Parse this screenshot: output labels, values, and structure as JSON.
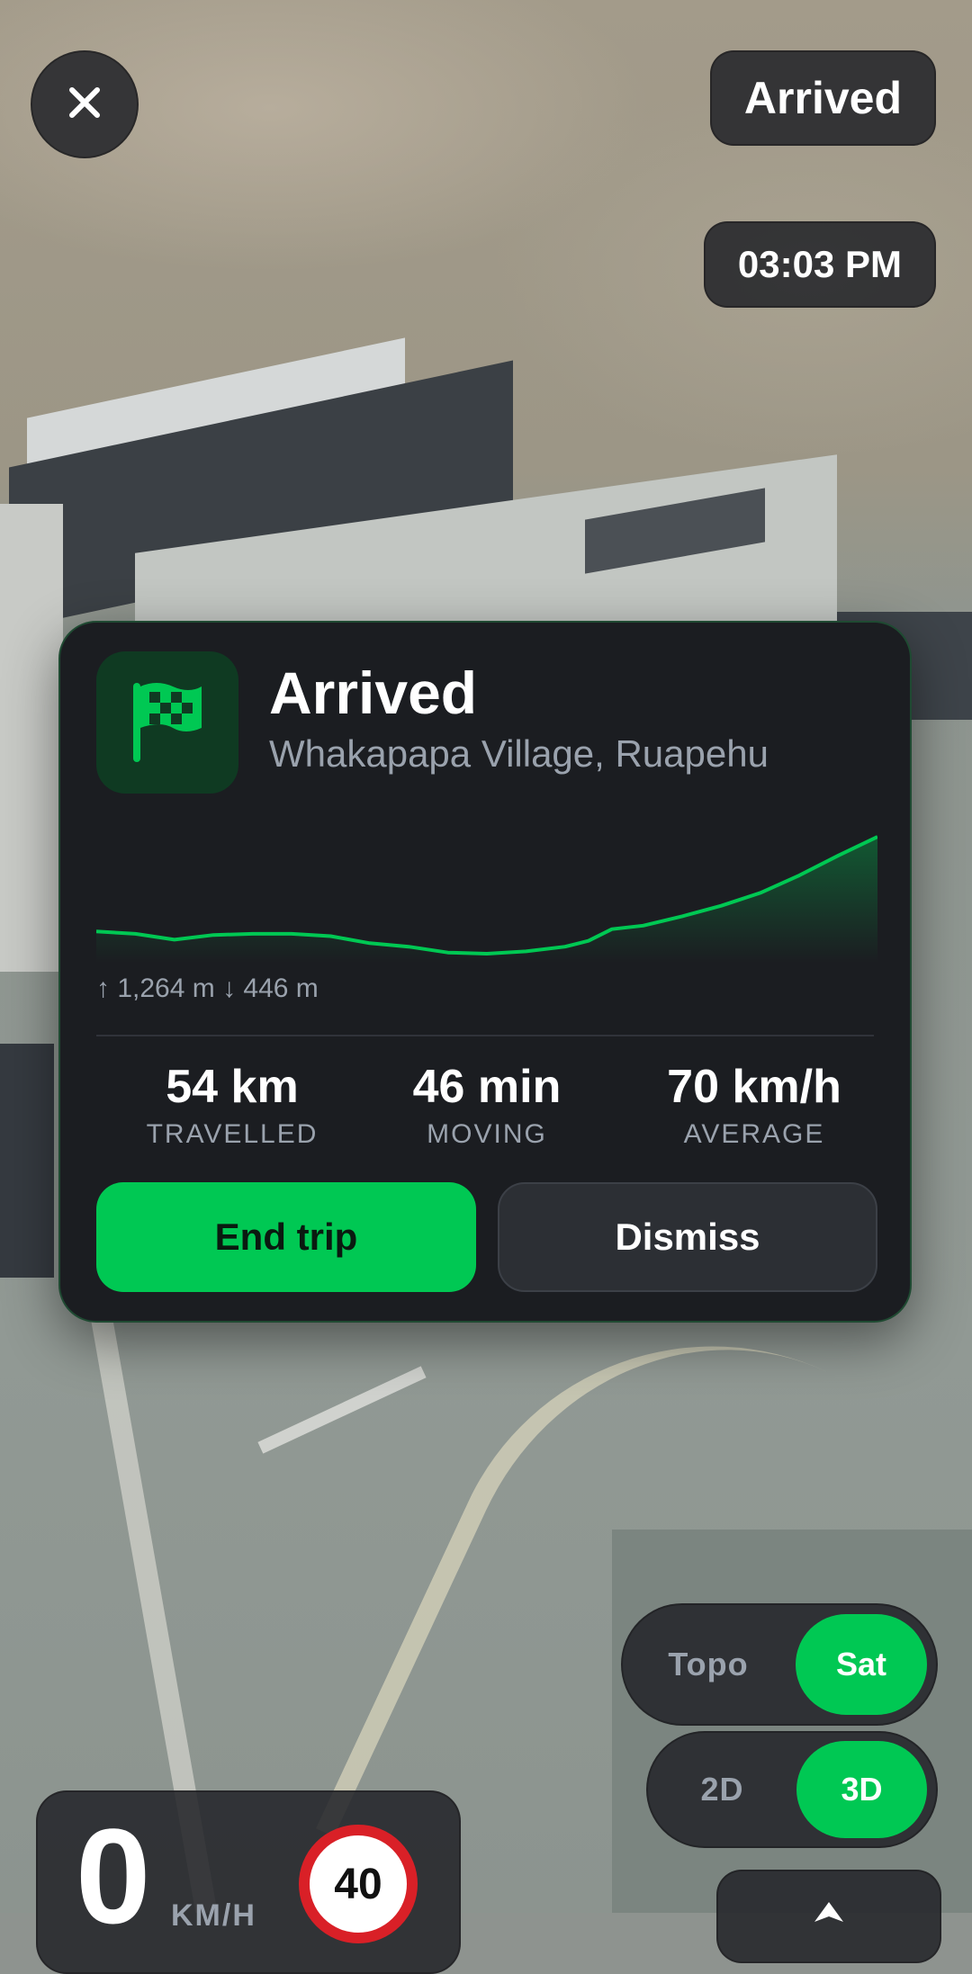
{
  "top_bar": {
    "close_icon": "close-icon",
    "status_badge": "Arrived",
    "time": "03:03 PM"
  },
  "arrival_card": {
    "icon": "checkered-flag-icon",
    "title": "Arrived",
    "location": "Whakapapa Village, Ruapehu",
    "elevation_summary": "↑ 1,264 m ↓ 446 m",
    "elevation_profile": {
      "type": "area",
      "x": [
        0,
        5,
        10,
        15,
        20,
        25,
        30,
        35,
        40,
        45,
        50,
        55,
        60,
        63,
        66,
        70,
        75,
        80,
        85,
        90,
        95,
        100
      ],
      "y": [
        0.19,
        0.17,
        0.12,
        0.16,
        0.17,
        0.17,
        0.15,
        0.09,
        0.06,
        0.01,
        0.0,
        0.02,
        0.06,
        0.11,
        0.21,
        0.24,
        0.32,
        0.41,
        0.52,
        0.67,
        0.84,
        1.0
      ]
    },
    "stats": [
      {
        "value": "54 km",
        "label": "TRAVELLED"
      },
      {
        "value": "46 min",
        "label": "MOVING"
      },
      {
        "value": "70 km/h",
        "label": "AVERAGE"
      }
    ],
    "end_trip_label": "End trip",
    "dismiss_label": "Dismiss",
    "accent": "#00c853"
  },
  "map_controls": {
    "style_toggle": {
      "options": [
        "Topo",
        "Sat"
      ],
      "selected": "Sat"
    },
    "view_toggle": {
      "options": [
        "2D",
        "3D"
      ],
      "selected": "3D"
    },
    "recenter_icon": "navigation-arrow-icon"
  },
  "speed": {
    "value": "0",
    "unit": "KM/H",
    "limit": "40"
  }
}
